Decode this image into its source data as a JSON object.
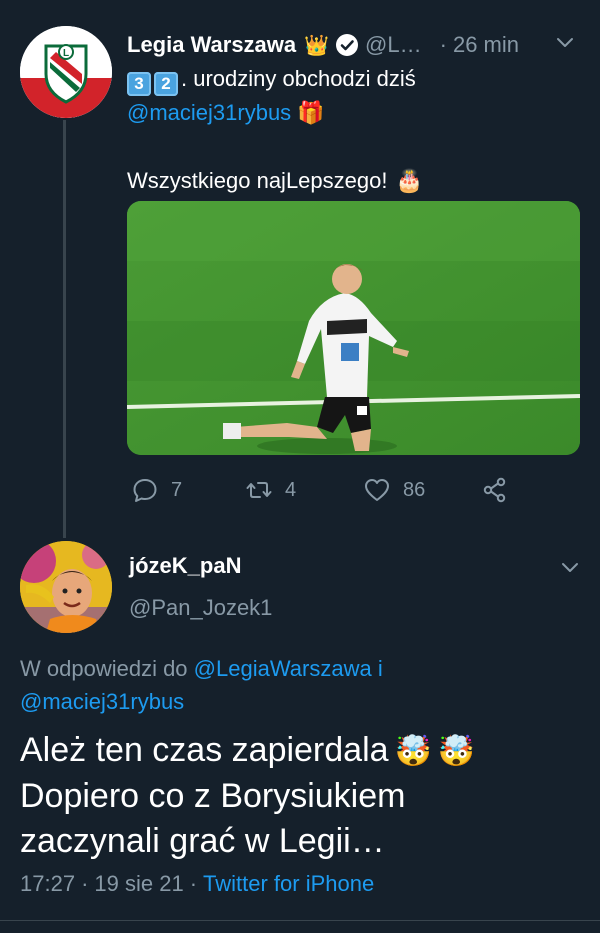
{
  "tweet1": {
    "author_name": "Legia Warszawa",
    "crown_emoji": "👑",
    "handle": "@L…",
    "dot": "·",
    "time": "26 min",
    "keycap1": "3",
    "keycap2": "2",
    "text_after_keycaps": ". urodziny obchodzi dziś",
    "mention": "@maciej31rybus",
    "gift_emoji": "🎁",
    "line2": "Wszystkiego najLepszego!",
    "cake_emoji": "🎂",
    "actions": {
      "reply_count": "7",
      "retweet_count": "4",
      "like_count": "86"
    }
  },
  "tweet2": {
    "author_name": "józeK_paN",
    "handle": "@Pan_Jozek1",
    "reply_prefix": "W odpowiedzi do",
    "reply_mention1": "@LegiaWarszawa",
    "reply_joiner": "i",
    "reply_mention2": "@maciej31rybus",
    "body_line1": "Ależ ten czas zapierdala",
    "emoji": "🤯",
    "body_line2": "Dopiero co z Borysiukiem",
    "body_line3": "zaczynali grać w Legii…",
    "time": "17:27",
    "date": "19 sie 21",
    "sep": "·",
    "source": "Twitter for iPhone"
  },
  "colors": {
    "background": "#15202b",
    "link": "#1d9bf0",
    "muted": "#8899a6",
    "divider": "#38444d"
  }
}
